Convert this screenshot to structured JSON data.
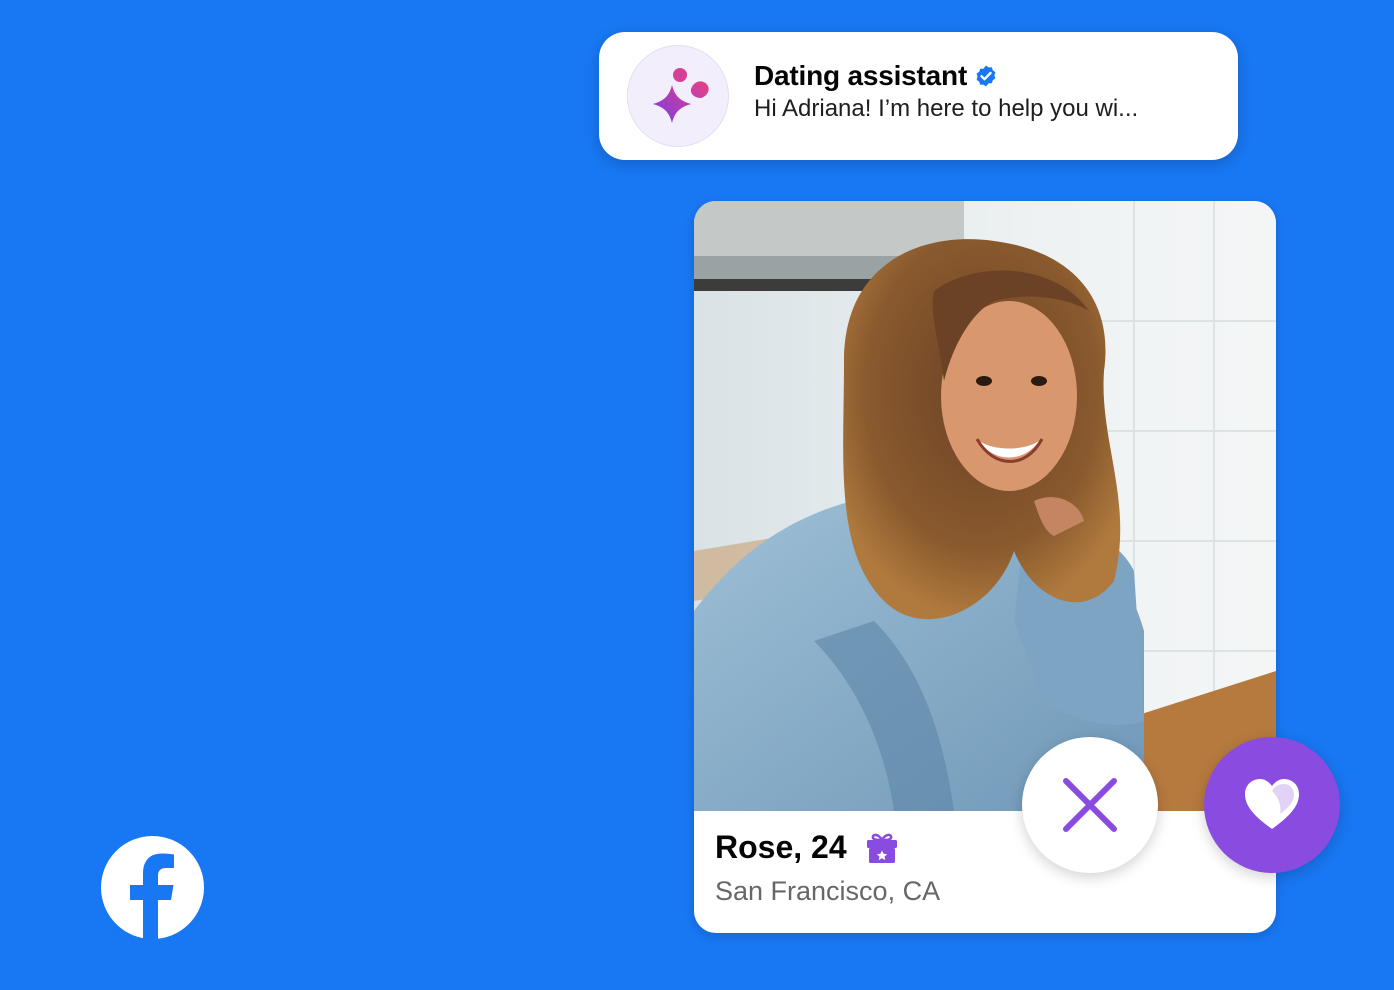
{
  "assistant": {
    "title": "Dating assistant",
    "preview": "Hi Adriana! I’m here to help you wi...",
    "avatar_icon": "sparkle-people-icon",
    "verified_icon": "verified-badge-icon"
  },
  "profile": {
    "name_age": "Rose, 24",
    "location": "San Francisco, CA",
    "badge_icon": "gift-icon"
  },
  "actions": {
    "pass_icon": "close-x-icon",
    "like_icon": "heart-icon"
  },
  "brand": {
    "logo_icon": "facebook-logo-icon"
  },
  "colors": {
    "background": "#1877F2",
    "accent_purple": "#8A4BE0",
    "verified_blue": "#1877F2"
  }
}
